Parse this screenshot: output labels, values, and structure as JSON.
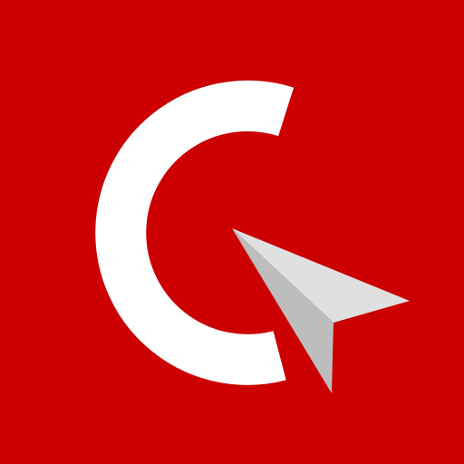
{
  "icon": {
    "name": "app-logo",
    "glyphs": [
      "letter-c-icon",
      "paper-plane-cursor-icon"
    ],
    "colors": {
      "background": "#cc0000",
      "letter": "#ffffff",
      "plane_light": "#e0e0e0",
      "plane_dark": "#bdbdbd"
    }
  }
}
